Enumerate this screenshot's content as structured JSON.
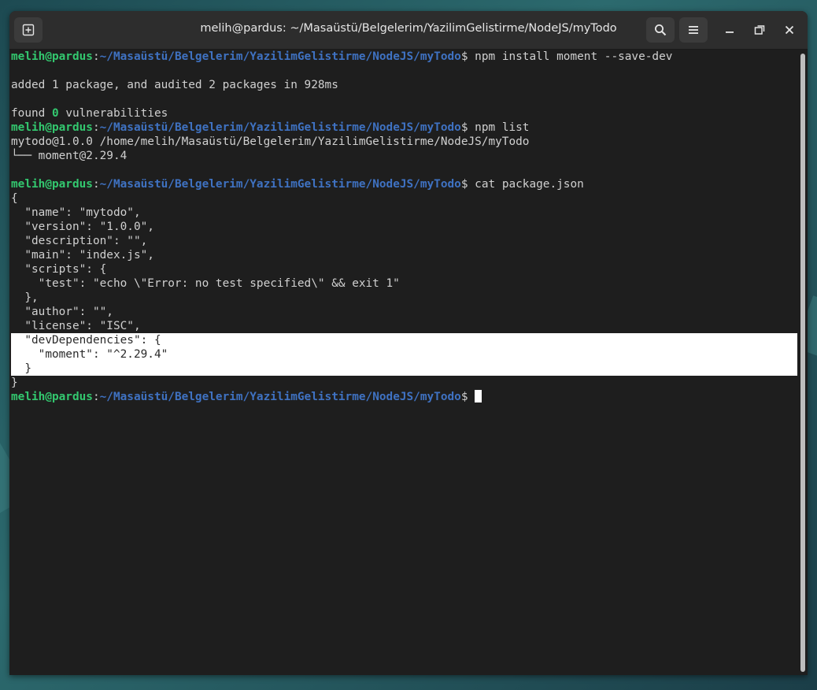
{
  "window": {
    "title": "melih@pardus: ~/Masaüstü/Belgelerim/YazilimGelistirme/NodeJS/myTodo"
  },
  "titlebar_icons": {
    "new_tab": "new-tab-icon",
    "search": "search-icon",
    "menu": "hamburger-menu-icon",
    "minimize": "minimize-icon",
    "maximize": "maximize-icon",
    "close": "close-icon"
  },
  "prompt": {
    "user": "melih@pardus",
    "sep": ":",
    "path": "~/Masaüstü/Belgelerim/YazilimGelistirme/NodeJS/myTodo",
    "dollar": "$"
  },
  "terminal": {
    "cmd1": " npm install moment --save-dev",
    "out_added": "added 1 package, and audited 2 packages in 928ms",
    "found_prefix": "found ",
    "found_count": "0",
    "found_suffix": " vulnerabilities",
    "cmd2": " npm list",
    "tree_root": "mytodo@1.0.0 /home/melih/Masaüstü/Belgelerim/YazilimGelistirme/NodeJS/myTodo",
    "tree_child": "└── moment@2.29.4",
    "cmd3": " cat package.json",
    "json_lines": [
      "{",
      "  \"name\": \"mytodo\",",
      "  \"version\": \"1.0.0\",",
      "  \"description\": \"\",",
      "  \"main\": \"index.js\",",
      "  \"scripts\": {",
      "    \"test\": \"echo \\\"Error: no test specified\\\" && exit 1\"",
      "  },",
      "  \"author\": \"\",",
      "  \"license\": \"ISC\",",
      "  \"devDependencies\": {",
      "    \"moment\": \"^2.29.4\"",
      "  }",
      "}"
    ],
    "final_input": " "
  },
  "colors": {
    "prompt_user": "#33c86f",
    "prompt_path": "#3f72c2",
    "terminal_bg": "#1e1e1e",
    "selection_bg": "#ffffff"
  }
}
